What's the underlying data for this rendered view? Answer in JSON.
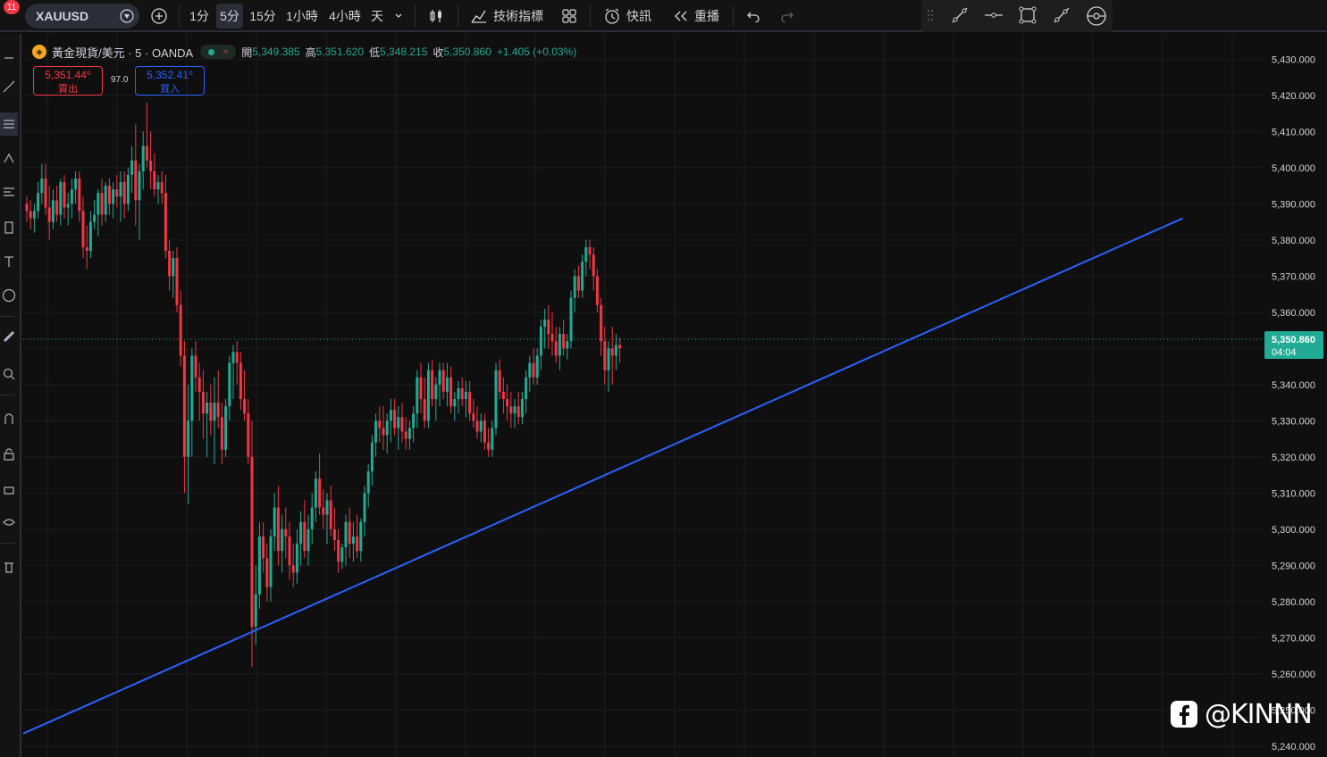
{
  "toolbar": {
    "notification_count": "11",
    "symbol": "XAUUSD",
    "intervals": [
      "1分",
      "5分",
      "15分",
      "1小時",
      "4小時",
      "天"
    ],
    "active_interval": "5分",
    "indicators_label": "技術指標",
    "alert_label": "快訊",
    "replay_label": "重播"
  },
  "legend": {
    "title": "黃金現貨/美元 · 5 · OANDA",
    "open_label": "開",
    "open": "5,349.385",
    "high_label": "高",
    "high": "5,351.620",
    "low_label": "低",
    "low": "5,348.215",
    "close_label": "收",
    "close": "5,350.860",
    "change": "+1.405 (+0.03%)"
  },
  "trade": {
    "sell_price": "5,351.44⁰",
    "sell_label": "賣出",
    "spread": "97.0",
    "buy_price": "5,352.41⁰",
    "buy_label": "買入"
  },
  "price_axis": {
    "ticks": [
      "5,430.000",
      "5,420.000",
      "5,410.000",
      "5,400.000",
      "5,390.000",
      "5,380.000",
      "5,370.000",
      "5,360.000",
      "5,350.000",
      "5,340.000",
      "5,330.000",
      "5,320.000",
      "5,310.000",
      "5,300.000",
      "5,290.000",
      "5,280.000",
      "5,270.000",
      "5,260.000",
      "5,250.000",
      "5,240.000"
    ],
    "current_price": "5,350.860",
    "countdown": "04:04"
  },
  "watermark": {
    "handle": "@KINNN"
  },
  "colors": {
    "up": "#22ab94",
    "down": "#f23645",
    "trendline": "#2962ff",
    "background": "#0f0f0f"
  },
  "chart_data": {
    "type": "candlestick",
    "symbol": "XAUUSD",
    "interval": "5",
    "ylim": [
      5237,
      5437
    ],
    "ohlc": [
      [
        5390,
        5392,
        5385,
        5388
      ],
      [
        5388,
        5391,
        5383,
        5386
      ],
      [
        5386,
        5390,
        5382,
        5388
      ],
      [
        5388,
        5396,
        5386,
        5393
      ],
      [
        5393,
        5401,
        5390,
        5397
      ],
      [
        5397,
        5401,
        5387,
        5389
      ],
      [
        5389,
        5395,
        5380,
        5385
      ],
      [
        5385,
        5394,
        5383,
        5391
      ],
      [
        5391,
        5395,
        5385,
        5387
      ],
      [
        5387,
        5397,
        5384,
        5396
      ],
      [
        5396,
        5398,
        5386,
        5389
      ],
      [
        5389,
        5393,
        5384,
        5390
      ],
      [
        5390,
        5397,
        5386,
        5394
      ],
      [
        5394,
        5399,
        5390,
        5397
      ],
      [
        5397,
        5399,
        5385,
        5388
      ],
      [
        5388,
        5392,
        5375,
        5378
      ],
      [
        5378,
        5384,
        5372,
        5377
      ],
      [
        5377,
        5388,
        5375,
        5385
      ],
      [
        5385,
        5391,
        5383,
        5387
      ],
      [
        5387,
        5394,
        5381,
        5393
      ],
      [
        5393,
        5397,
        5384,
        5387
      ],
      [
        5387,
        5396,
        5385,
        5395
      ],
      [
        5395,
        5397,
        5387,
        5390
      ],
      [
        5390,
        5396,
        5386,
        5394
      ],
      [
        5394,
        5398,
        5389,
        5392
      ],
      [
        5392,
        5399,
        5385,
        5396
      ],
      [
        5396,
        5399,
        5386,
        5390
      ],
      [
        5390,
        5400,
        5388,
        5398
      ],
      [
        5398,
        5406,
        5393,
        5402
      ],
      [
        5402,
        5412,
        5384,
        5391
      ],
      [
        5391,
        5401,
        5380,
        5399
      ],
      [
        5399,
        5410,
        5394,
        5406
      ],
      [
        5406,
        5418,
        5400,
        5402
      ],
      [
        5402,
        5410,
        5394,
        5399
      ],
      [
        5399,
        5404,
        5392,
        5394
      ],
      [
        5394,
        5398,
        5390,
        5396
      ],
      [
        5396,
        5399,
        5390,
        5393
      ],
      [
        5393,
        5398,
        5375,
        5377
      ],
      [
        5377,
        5380,
        5366,
        5370
      ],
      [
        5370,
        5377,
        5364,
        5375
      ],
      [
        5375,
        5378,
        5360,
        5362
      ],
      [
        5362,
        5366,
        5345,
        5348
      ],
      [
        5348,
        5352,
        5310,
        5320
      ],
      [
        5320,
        5340,
        5307,
        5330
      ],
      [
        5330,
        5350,
        5320,
        5348
      ],
      [
        5348,
        5352,
        5338,
        5342
      ],
      [
        5342,
        5346,
        5330,
        5338
      ],
      [
        5338,
        5344,
        5325,
        5332
      ],
      [
        5332,
        5338,
        5320,
        5335
      ],
      [
        5335,
        5340,
        5326,
        5330
      ],
      [
        5330,
        5342,
        5318,
        5335
      ],
      [
        5335,
        5344,
        5328,
        5331
      ],
      [
        5331,
        5335,
        5318,
        5322
      ],
      [
        5322,
        5336,
        5320,
        5334
      ],
      [
        5334,
        5348,
        5330,
        5346
      ],
      [
        5346,
        5351,
        5336,
        5349
      ],
      [
        5349,
        5352,
        5340,
        5346
      ],
      [
        5346,
        5349,
        5333,
        5336
      ],
      [
        5336,
        5344,
        5330,
        5332
      ],
      [
        5332,
        5336,
        5318,
        5320
      ],
      [
        5320,
        5330,
        5262,
        5273
      ],
      [
        5273,
        5290,
        5268,
        5282
      ],
      [
        5282,
        5302,
        5278,
        5298
      ],
      [
        5298,
        5302,
        5288,
        5292
      ],
      [
        5292,
        5296,
        5280,
        5284
      ],
      [
        5284,
        5300,
        5280,
        5298
      ],
      [
        5298,
        5310,
        5294,
        5306
      ],
      [
        5306,
        5312,
        5290,
        5294
      ],
      [
        5294,
        5304,
        5288,
        5300
      ],
      [
        5300,
        5306,
        5292,
        5298
      ],
      [
        5298,
        5302,
        5286,
        5290
      ],
      [
        5290,
        5296,
        5284,
        5288
      ],
      [
        5288,
        5300,
        5285,
        5296
      ],
      [
        5296,
        5305,
        5290,
        5302
      ],
      [
        5302,
        5308,
        5292,
        5294
      ],
      [
        5294,
        5304,
        5290,
        5300
      ],
      [
        5300,
        5310,
        5296,
        5306
      ],
      [
        5306,
        5316,
        5302,
        5314
      ],
      [
        5314,
        5321,
        5304,
        5306
      ],
      [
        5306,
        5311,
        5300,
        5304
      ],
      [
        5304,
        5310,
        5296,
        5308
      ],
      [
        5308,
        5312,
        5298,
        5300
      ],
      [
        5300,
        5306,
        5294,
        5297
      ],
      [
        5297,
        5300,
        5288,
        5291
      ],
      [
        5291,
        5296,
        5289,
        5295
      ],
      [
        5295,
        5304,
        5290,
        5302
      ],
      [
        5302,
        5306,
        5292,
        5296
      ],
      [
        5296,
        5302,
        5291,
        5298
      ],
      [
        5298,
        5304,
        5292,
        5294
      ],
      [
        5294,
        5303,
        5291,
        5302
      ],
      [
        5302,
        5312,
        5298,
        5310
      ],
      [
        5310,
        5318,
        5306,
        5316
      ],
      [
        5316,
        5326,
        5312,
        5324
      ],
      [
        5324,
        5332,
        5320,
        5330
      ],
      [
        5330,
        5334,
        5324,
        5328
      ],
      [
        5328,
        5334,
        5322,
        5326
      ],
      [
        5326,
        5332,
        5321,
        5330
      ],
      [
        5330,
        5336,
        5324,
        5333
      ],
      [
        5333,
        5336,
        5326,
        5328
      ],
      [
        5328,
        5334,
        5322,
        5331
      ],
      [
        5331,
        5335,
        5324,
        5327
      ],
      [
        5327,
        5331,
        5322,
        5325
      ],
      [
        5325,
        5330,
        5322,
        5328
      ],
      [
        5328,
        5334,
        5324,
        5332
      ],
      [
        5332,
        5344,
        5328,
        5342
      ],
      [
        5342,
        5346,
        5332,
        5336
      ],
      [
        5336,
        5342,
        5328,
        5330
      ],
      [
        5330,
        5346,
        5328,
        5344
      ],
      [
        5344,
        5347,
        5334,
        5336
      ],
      [
        5336,
        5342,
        5330,
        5340
      ],
      [
        5340,
        5346,
        5334,
        5344
      ],
      [
        5344,
        5346,
        5336,
        5338
      ],
      [
        5338,
        5346,
        5334,
        5342
      ],
      [
        5342,
        5345,
        5332,
        5334
      ],
      [
        5334,
        5338,
        5330,
        5336
      ],
      [
        5336,
        5341,
        5332,
        5339
      ],
      [
        5339,
        5342,
        5334,
        5336
      ],
      [
        5336,
        5341,
        5331,
        5338
      ],
      [
        5338,
        5341,
        5330,
        5332
      ],
      [
        5332,
        5336,
        5328,
        5330
      ],
      [
        5330,
        5334,
        5325,
        5327
      ],
      [
        5327,
        5332,
        5324,
        5330
      ],
      [
        5330,
        5332,
        5322,
        5324
      ],
      [
        5324,
        5328,
        5320,
        5322
      ],
      [
        5322,
        5330,
        5320,
        5328
      ],
      [
        5328,
        5346,
        5326,
        5344
      ],
      [
        5344,
        5347,
        5336,
        5338
      ],
      [
        5338,
        5342,
        5332,
        5336
      ],
      [
        5336,
        5340,
        5330,
        5334
      ],
      [
        5334,
        5338,
        5328,
        5332
      ],
      [
        5332,
        5336,
        5328,
        5334
      ],
      [
        5334,
        5338,
        5329,
        5331
      ],
      [
        5331,
        5338,
        5329,
        5336
      ],
      [
        5336,
        5344,
        5332,
        5342
      ],
      [
        5342,
        5348,
        5338,
        5346
      ],
      [
        5346,
        5350,
        5340,
        5342
      ],
      [
        5342,
        5350,
        5340,
        5348
      ],
      [
        5348,
        5358,
        5344,
        5356
      ],
      [
        5356,
        5361,
        5350,
        5358
      ],
      [
        5358,
        5362,
        5350,
        5354
      ],
      [
        5354,
        5360,
        5348,
        5352
      ],
      [
        5352,
        5356,
        5346,
        5348
      ],
      [
        5348,
        5356,
        5344,
        5354
      ],
      [
        5354,
        5358,
        5348,
        5350
      ],
      [
        5350,
        5354,
        5347,
        5352
      ],
      [
        5352,
        5366,
        5350,
        5364
      ],
      [
        5364,
        5372,
        5360,
        5370
      ],
      [
        5370,
        5373,
        5364,
        5366
      ],
      [
        5366,
        5376,
        5364,
        5374
      ],
      [
        5374,
        5380,
        5370,
        5378
      ],
      [
        5378,
        5380,
        5372,
        5376
      ],
      [
        5376,
        5378,
        5366,
        5370
      ],
      [
        5370,
        5372,
        5360,
        5362
      ],
      [
        5362,
        5364,
        5348,
        5352
      ],
      [
        5352,
        5356,
        5340,
        5344
      ],
      [
        5344,
        5352,
        5338,
        5350
      ],
      [
        5350,
        5356,
        5340,
        5348
      ],
      [
        5348,
        5354,
        5344,
        5351
      ],
      [
        5351,
        5353,
        5346,
        5350
      ]
    ],
    "trendline": {
      "from": {
        "bar": -15,
        "price": 5237
      },
      "to": {
        "bar": 308,
        "price": 5386
      }
    }
  }
}
